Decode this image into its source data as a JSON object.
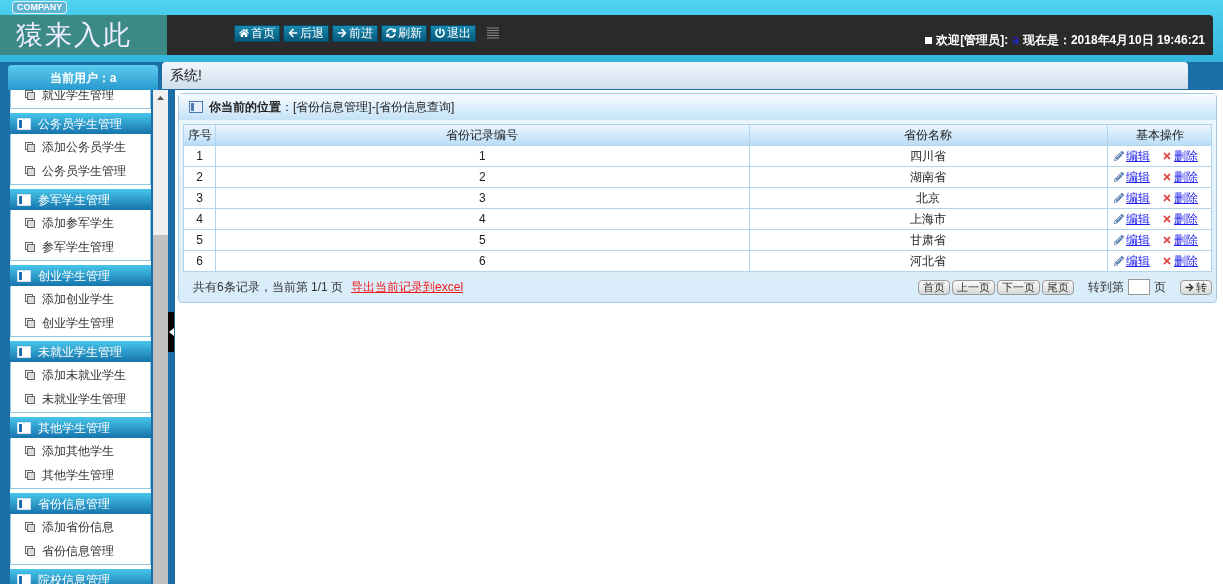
{
  "header": {
    "company": "COMPANY",
    "logo": "猿来入此",
    "toolbar": [
      "首页",
      "后退",
      "前进",
      "刷新",
      "退出"
    ],
    "welcome": "欢迎[管理员]:",
    "user": "a",
    "now": "现在是：2018年4月10日 19:46:21"
  },
  "user_tab": "当前用户：a",
  "system_bar": "系统!",
  "sidebar": {
    "groups": [
      {
        "items": [
          "就业学生管理"
        ]
      },
      {
        "title": "公务员学生管理",
        "items": [
          "添加公务员学生",
          "公务员学生管理"
        ]
      },
      {
        "title": "参军学生管理",
        "items": [
          "添加参军学生",
          "参军学生管理"
        ]
      },
      {
        "title": "创业学生管理",
        "items": [
          "添加创业学生",
          "创业学生管理"
        ]
      },
      {
        "title": "未就业学生管理",
        "items": [
          "添加未就业学生",
          "未就业学生管理"
        ]
      },
      {
        "title": "其他学生管理",
        "items": [
          "添加其他学生",
          "其他学生管理"
        ]
      },
      {
        "title": "省份信息管理",
        "items": [
          "添加省份信息",
          "省份信息管理"
        ]
      },
      {
        "title": "院校信息管理"
      }
    ]
  },
  "breadcrumb": {
    "label": "你当前的位置",
    "path": "：[省份信息管理]-[省份信息查询]"
  },
  "table": {
    "columns": [
      "序号",
      "省份记录编号",
      "省份名称",
      "基本操作"
    ],
    "rows": [
      {
        "cells": [
          "1",
          "1",
          "四川省"
        ],
        "edit": "编辑",
        "delete": "删除"
      },
      {
        "cells": [
          "2",
          "2",
          "湖南省"
        ],
        "edit": "编辑",
        "delete": "删除"
      },
      {
        "cells": [
          "3",
          "3",
          "北京"
        ],
        "edit": "编辑",
        "delete": "删除"
      },
      {
        "cells": [
          "4",
          "4",
          "上海市"
        ],
        "edit": "编辑",
        "delete": "删除"
      },
      {
        "cells": [
          "5",
          "5",
          "甘肃省"
        ],
        "edit": "编辑",
        "delete": "删除"
      },
      {
        "cells": [
          "6",
          "6",
          "河北省"
        ],
        "edit": "编辑",
        "delete": "删除"
      }
    ]
  },
  "footer": {
    "summary": "共有6条记录，当前第 1/1 页",
    "export": "导出当前记录到excel",
    "pager": [
      "首页",
      "上一页",
      "下一页",
      "尾页"
    ],
    "goto": "转到第",
    "page": "页",
    "go": "转"
  }
}
